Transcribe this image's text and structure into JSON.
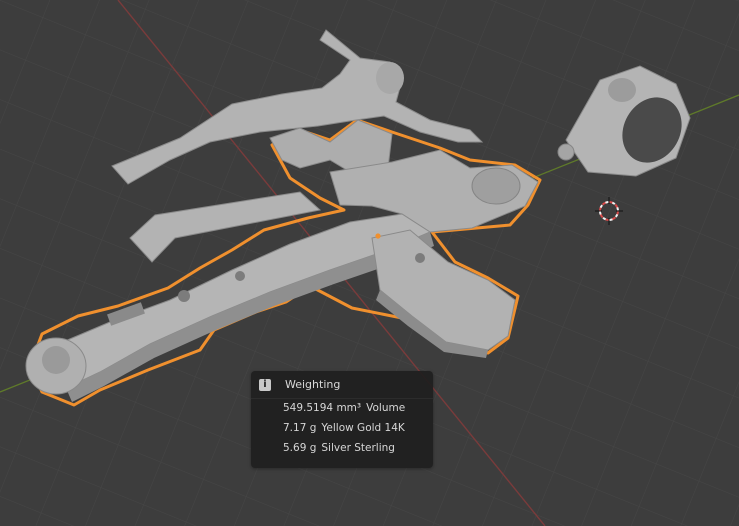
{
  "viewport": {
    "background": "#3d3d3d",
    "grid_color": "#464646",
    "x_axis_color": "#7a3b3b",
    "y_axis_color": "#5f7a2a",
    "selection_outline_color": "#f0902e",
    "model_color": "#a9a9a9"
  },
  "weighting_panel": {
    "icon": "info-icon",
    "icon_glyph": "i",
    "title": "Weighting",
    "rows": [
      {
        "value": "549.5194 mm³",
        "label": "Volume"
      },
      {
        "value": "7.17 g",
        "label": "Yellow Gold 14K"
      },
      {
        "value": "5.69 g",
        "label": "Silver Sterling"
      }
    ]
  }
}
